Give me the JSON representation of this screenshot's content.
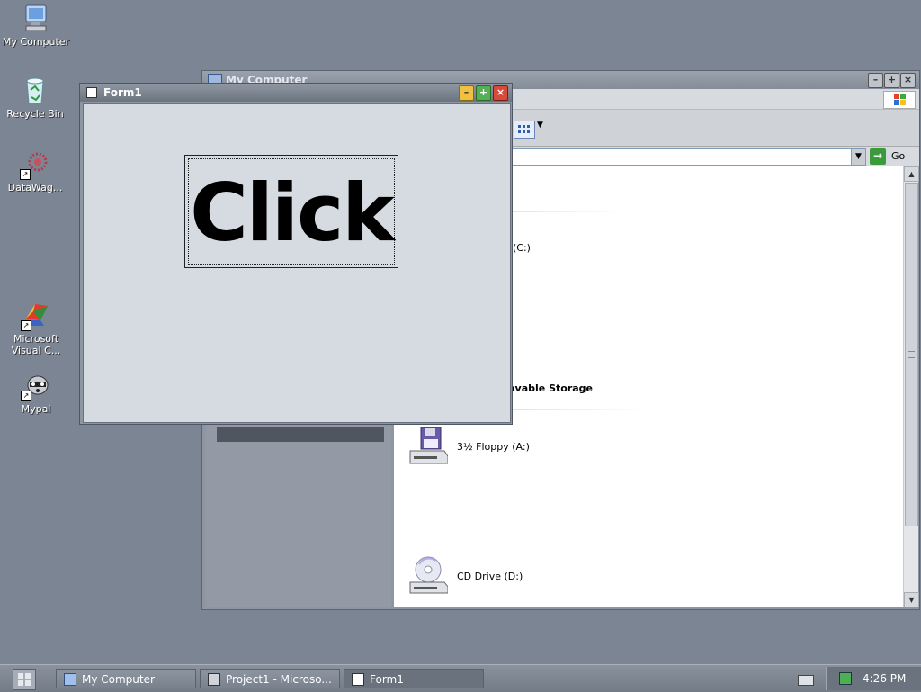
{
  "desktop": {
    "icons": [
      {
        "label": "My Computer"
      },
      {
        "label": "Recycle Bin"
      },
      {
        "label": "DataWag..."
      },
      {
        "label": "Microsoft Visual C..."
      },
      {
        "label": "Mypal"
      }
    ]
  },
  "my_computer_window": {
    "title": "My Computer",
    "address_go_label": "Go",
    "drive_c_label": "(C:)",
    "removable_header": "ovable Storage",
    "floppy_label": "3½ Floppy (A:)",
    "cd_label": "CD Drive (D:)"
  },
  "form1_window": {
    "title": "Form1",
    "button_caption": "Click"
  },
  "taskbar": {
    "tasks": [
      {
        "label": "My Computer"
      },
      {
        "label": "Project1 - Microso..."
      },
      {
        "label": "Form1"
      }
    ],
    "clock": "4:26 PM"
  }
}
